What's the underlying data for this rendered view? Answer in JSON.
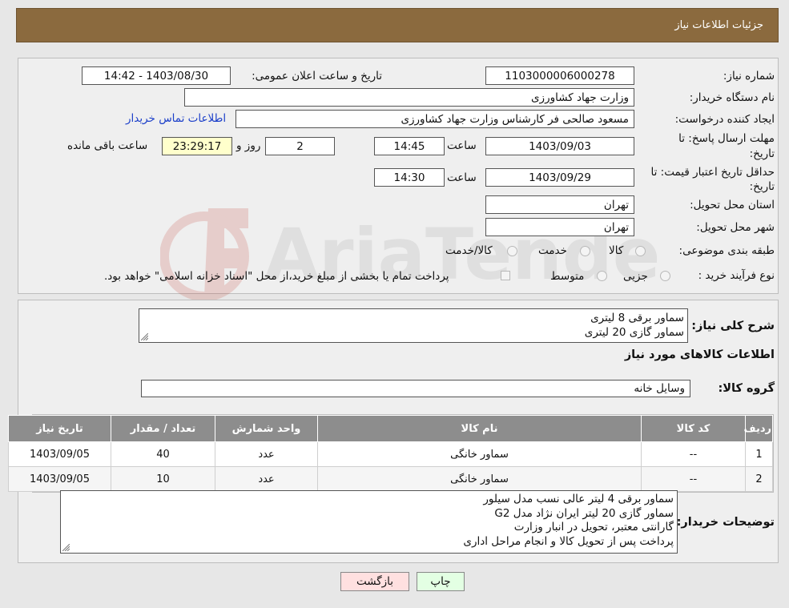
{
  "header": {
    "title": "جزئیات اطلاعات نیاز"
  },
  "watermark": {
    "text": "AriaTender.neT"
  },
  "form": {
    "need_number_label": "شماره نیاز:",
    "need_number": "1103000006000278",
    "announce_label": "تاریخ و ساعت اعلان عمومی:",
    "announce_value": "1403/08/30 - 14:42",
    "buyer_org_label": "نام دستگاه خریدار:",
    "buyer_org": "وزارت جهاد کشاورزی",
    "creator_label": "ایجاد کننده درخواست:",
    "creator": "مسعود صالحی فر کارشناس وزارت جهاد کشاورزی",
    "contact_link": "اطلاعات تماس خریدار",
    "deadline_label_1": "مهلت ارسال پاسخ: تا",
    "deadline_label_2": "تاریخ:",
    "deadline_date": "1403/09/03",
    "time_label": "ساعت",
    "deadline_time": "14:45",
    "days_value": "2",
    "days_label": "روز و",
    "remaining_time": "23:29:17",
    "remaining_label": "ساعت باقی مانده",
    "validity_label_1": "حداقل تاریخ اعتبار قیمت: تا",
    "validity_label_2": "تاریخ:",
    "validity_date": "1403/09/29",
    "validity_time": "14:30",
    "province_label": "استان محل تحویل:",
    "province": "تهران",
    "city_label": "شهر محل تحویل:",
    "city": "تهران",
    "category_label": "طبقه بندی موضوعی:",
    "category_options": [
      "کالا",
      "خدمت",
      "کالا/خدمت"
    ],
    "process_label": "نوع فرآیند خرید :",
    "process_options": [
      "جزیی",
      "متوسط"
    ],
    "payment_note": "پرداخت تمام یا بخشی از مبلغ خرید،از محل \"اسناد خزانه اسلامی\" خواهد بود."
  },
  "summary": {
    "desc_label": "شرح کلی نیاز:",
    "desc_lines": [
      "سماور برقی 8 لیتری",
      "سماور گازی 20 لیتری"
    ],
    "items_title": "اطلاعات کالاهای مورد نیاز",
    "group_label": "گروه کالا:",
    "group_value": "وسایل خانه"
  },
  "table": {
    "headers": [
      "ردیف",
      "کد کالا",
      "نام کالا",
      "واحد شمارش",
      "تعداد / مقدار",
      "تاریخ نیاز"
    ],
    "rows": [
      [
        "1",
        "--",
        "سماور خانگی",
        "عدد",
        "40",
        "1403/09/05"
      ],
      [
        "2",
        "--",
        "سماور خانگی",
        "عدد",
        "10",
        "1403/09/05"
      ]
    ]
  },
  "notes": {
    "label": "توضیحات خریدار:",
    "lines": [
      "سماور برقی 4 لیتر عالی نسب مدل سیلور",
      "سماور گازی 20 لیتر ایران نژاد مدل G2",
      "گارانتی معتبر، تحویل در انبار وزارت",
      "پرداخت پس از تحویل کالا و انجام مراحل اداری"
    ]
  },
  "buttons": {
    "print": "چاپ",
    "back": "بازگشت"
  },
  "colors": {
    "header": "#8b6a3e",
    "table_header": "#8d8d8d",
    "remaining_bg": "#ffffcc",
    "back_btn": "#ffe0e0",
    "print_btn": "#e3ffe3",
    "link": "#1a3ec9"
  }
}
